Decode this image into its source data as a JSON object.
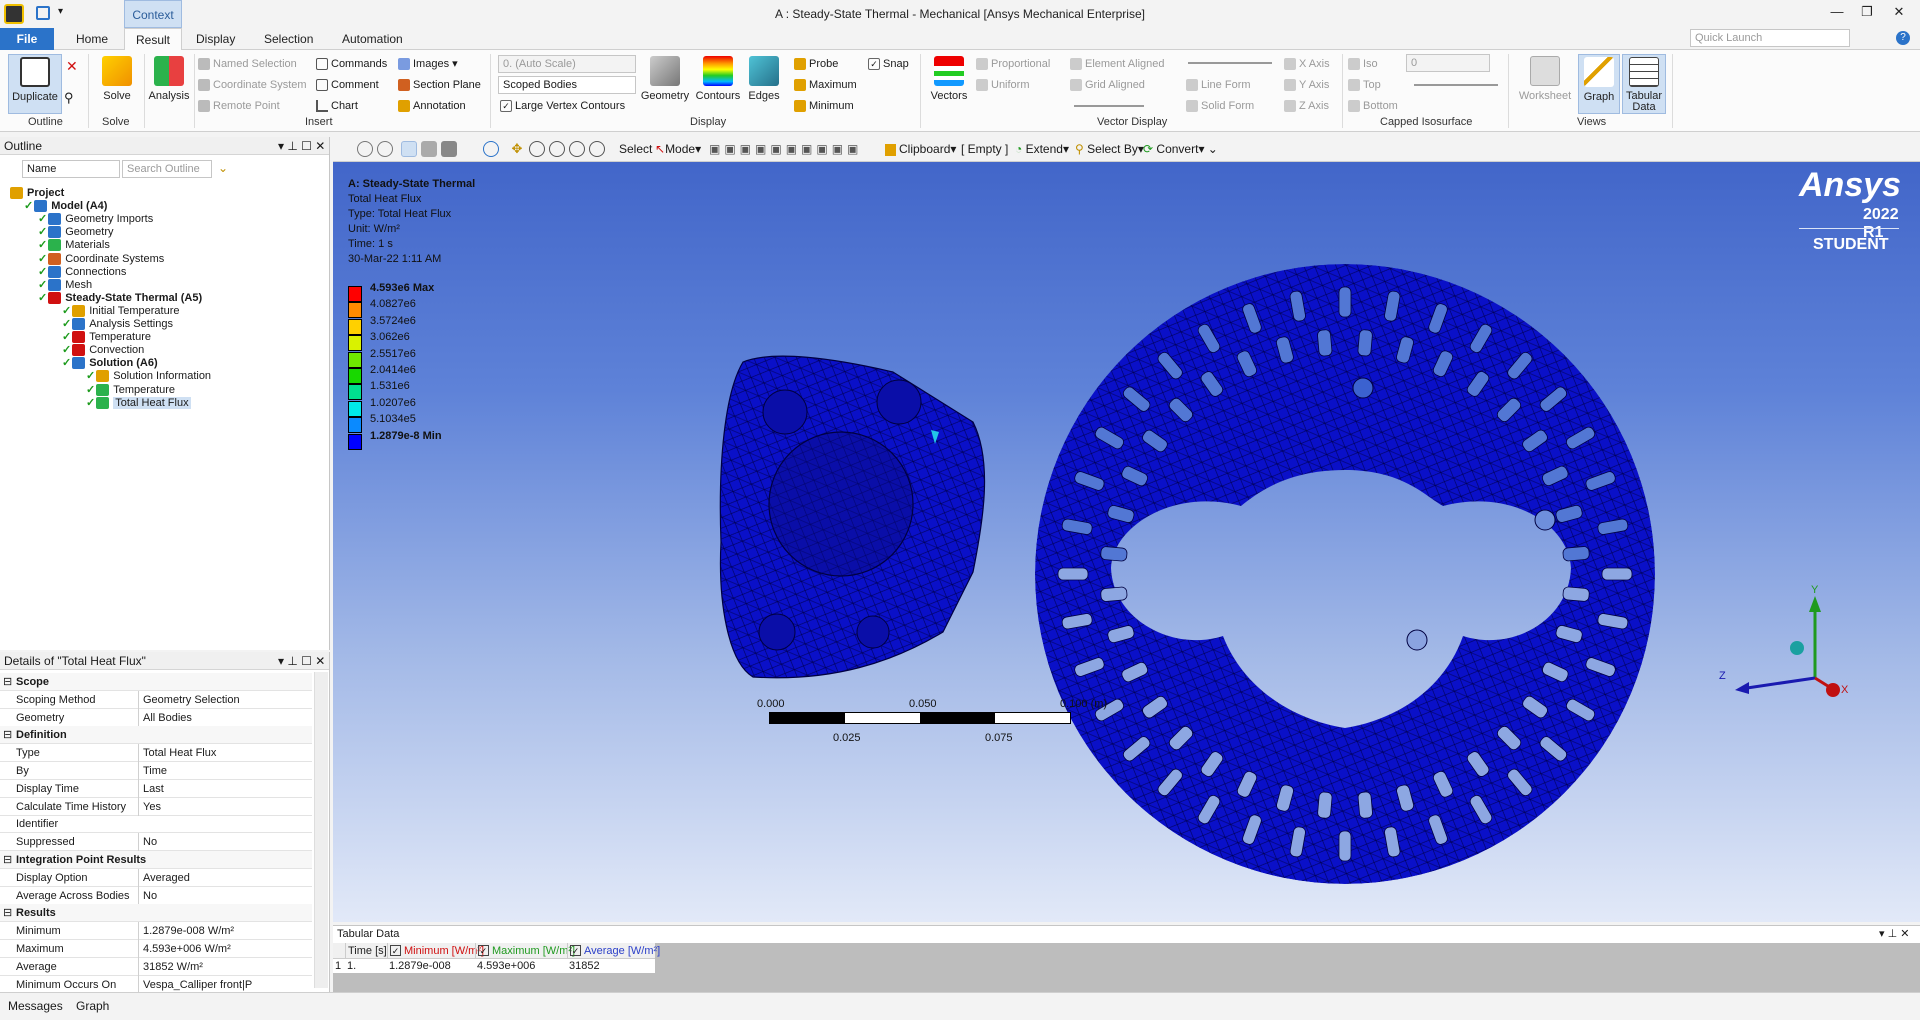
{
  "window": {
    "title": "A : Steady-State Thermal - Mechanical [Ansys Mechanical Enterprise]",
    "context_label": "Context"
  },
  "tabs": [
    "File",
    "Home",
    "Result",
    "Display",
    "Selection",
    "Automation"
  ],
  "quick_launch": {
    "placeholder": "Quick Launch"
  },
  "ribbon": {
    "outline_group": {
      "label": "Outline",
      "duplicate": "Duplicate"
    },
    "solve_group": {
      "label": "Solve",
      "solve": "Solve",
      "analysis": "Analysis"
    },
    "insert_group": {
      "label": "Insert",
      "items": [
        "Named Selection",
        "Coordinate System",
        "Remote Point",
        "Commands",
        "Comment",
        "Chart",
        "Images",
        "Section Plane",
        "Annotation"
      ]
    },
    "display_group": {
      "label": "Display",
      "scale": "0. (Auto Scale)",
      "scoped": "Scoped Bodies",
      "large_vertex": "Large Vertex Contours",
      "geometry": "Geometry",
      "contours": "Contours",
      "edges": "Edges",
      "probe": "Probe",
      "maximum": "Maximum",
      "minimum": "Minimum",
      "snap": "Snap"
    },
    "vector_group": {
      "label": "Vector Display",
      "vectors": "Vectors",
      "proportional": "Proportional",
      "uniform": "Uniform",
      "element_aligned": "Element Aligned",
      "grid_aligned": "Grid Aligned",
      "line_form": "Line Form",
      "solid_form": "Solid Form",
      "x_axis": "X Axis",
      "y_axis": "Y Axis",
      "z_axis": "Z Axis"
    },
    "capped_group": {
      "label": "Capped Isosurface",
      "iso": "Iso",
      "top": "Top",
      "bottom": "Bottom",
      "value": "0"
    },
    "views_group": {
      "label": "Views",
      "worksheet": "Worksheet",
      "graph": "Graph",
      "tabular": "Tabular Data"
    }
  },
  "outline": {
    "title": "Outline",
    "filter_label": "Name",
    "search_placeholder": "Search Outline",
    "tree": [
      {
        "label": "Project",
        "bold": true
      },
      {
        "label": "Model (A4)",
        "bold": true
      },
      {
        "label": "Geometry Imports"
      },
      {
        "label": "Geometry"
      },
      {
        "label": "Materials"
      },
      {
        "label": "Coordinate Systems"
      },
      {
        "label": "Connections"
      },
      {
        "label": "Mesh"
      },
      {
        "label": "Steady-State Thermal (A5)",
        "bold": true
      },
      {
        "label": "Initial Temperature"
      },
      {
        "label": "Analysis Settings"
      },
      {
        "label": "Temperature"
      },
      {
        "label": "Convection"
      },
      {
        "label": "Solution (A6)",
        "bold": true
      },
      {
        "label": "Solution Information"
      },
      {
        "label": "Temperature"
      },
      {
        "label": "Total Heat Flux"
      }
    ]
  },
  "details": {
    "title": "Details of \"Total Heat Flux\"",
    "rows": [
      {
        "type": "section",
        "label": "Scope"
      },
      {
        "k": "Scoping Method",
        "v": "Geometry Selection"
      },
      {
        "k": "Geometry",
        "v": "All Bodies"
      },
      {
        "type": "section",
        "label": "Definition"
      },
      {
        "k": "Type",
        "v": "Total Heat Flux"
      },
      {
        "k": "By",
        "v": "Time"
      },
      {
        "k": "Display Time",
        "v": "Last"
      },
      {
        "k": "Calculate Time History",
        "v": "Yes"
      },
      {
        "k": "Identifier",
        "v": ""
      },
      {
        "k": "Suppressed",
        "v": "No"
      },
      {
        "type": "section",
        "label": "Integration Point Results"
      },
      {
        "k": "Display Option",
        "v": "Averaged"
      },
      {
        "k": "Average Across Bodies",
        "v": "No"
      },
      {
        "type": "section",
        "label": "Results"
      },
      {
        "k": "Minimum",
        "v": "1.2879e-008 W/m²"
      },
      {
        "k": "Maximum",
        "v": "4.593e+006 W/m²"
      },
      {
        "k": "Average",
        "v": "31852 W/m²"
      },
      {
        "k": "Minimum Occurs On",
        "v": "Vespa_Calliper front|P"
      }
    ]
  },
  "viewport_toolbar": {
    "select": "Select",
    "mode": "Mode",
    "clipboard": "Clipboard",
    "empty": "[ Empty ]",
    "extend": "Extend",
    "select_by": "Select By",
    "convert": "Convert"
  },
  "result_info": {
    "title": "A: Steady-State Thermal",
    "lines": [
      "Total Heat Flux",
      "Type: Total Heat Flux",
      "Unit: W/m²",
      "Time: 1 s",
      "30-Mar-22 1:11 AM"
    ]
  },
  "legend": {
    "labels": [
      "4.593e6 Max",
      "4.0827e6",
      "3.5724e6",
      "3.062e6",
      "2.5517e6",
      "2.0414e6",
      "1.531e6",
      "1.0207e6",
      "5.1034e5",
      "1.2879e-8 Min"
    ],
    "colors": [
      "#ff0000",
      "#ff8a00",
      "#ffd000",
      "#d9f200",
      "#6fe800",
      "#18d800",
      "#00e08f",
      "#00e8e8",
      "#0a8aff",
      "#0000ff"
    ]
  },
  "branding": {
    "logo": "Ansys",
    "version": "2022 R1",
    "edition": "STUDENT"
  },
  "scale_bar": {
    "top_labels": [
      "0.000",
      "0.050",
      "0.100 (m)"
    ],
    "bottom_labels": [
      "0.025",
      "0.075"
    ]
  },
  "triad": {
    "x": "X",
    "y": "Y",
    "z": "Z"
  },
  "tabular": {
    "title": "Tabular Data",
    "columns": [
      "Time [s]",
      "Minimum [W/m²]",
      "Maximum [W/m²]",
      "Average [W/m²]"
    ],
    "column_colors": [
      "#222222",
      "#d01010",
      "#1f9a1f",
      "#2b3fc9"
    ],
    "row": [
      "1",
      "1.",
      "1.2879e-008",
      "4.593e+006",
      "31852"
    ]
  },
  "status": {
    "tabs": [
      "Messages",
      "Graph"
    ]
  }
}
